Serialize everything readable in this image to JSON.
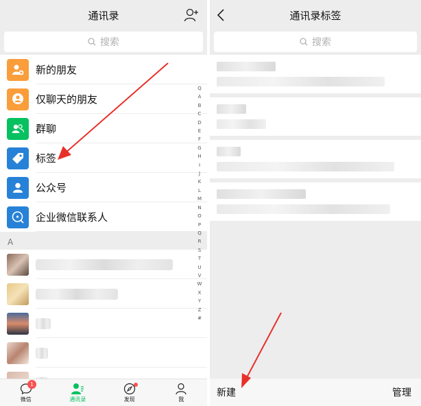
{
  "left": {
    "title": "通讯录",
    "search_placeholder": "搜索",
    "items": [
      {
        "label": "新的朋友",
        "icon": "new-friend-icon",
        "color": "#fa9d3b"
      },
      {
        "label": "仅聊天的朋友",
        "icon": "chat-only-friend-icon",
        "color": "#fa9d3b"
      },
      {
        "label": "群聊",
        "icon": "group-chat-icon",
        "color": "#07c160"
      },
      {
        "label": "标签",
        "icon": "tag-icon",
        "color": "#2782d7"
      },
      {
        "label": "公众号",
        "icon": "official-account-icon",
        "color": "#2782d7"
      },
      {
        "label": "企业微信联系人",
        "icon": "work-contact-icon",
        "color": "#2782d7"
      }
    ],
    "section_letter": "A",
    "index_letters": [
      "Q",
      "A",
      "B",
      "C",
      "D",
      "E",
      "F",
      "G",
      "H",
      "I",
      "J",
      "K",
      "L",
      "M",
      "N",
      "O",
      "P",
      "Q",
      "R",
      "S",
      "T",
      "U",
      "V",
      "W",
      "X",
      "Y",
      "Z",
      "#"
    ],
    "tabs": [
      {
        "label": "微信",
        "icon": "chat-bubble-icon",
        "badge": "1"
      },
      {
        "label": "通讯录",
        "icon": "contacts-icon"
      },
      {
        "label": "发现",
        "icon": "compass-icon"
      },
      {
        "label": "我",
        "icon": "person-icon"
      }
    ]
  },
  "right": {
    "title": "通讯录标签",
    "search_placeholder": "搜索",
    "new_label": "新建",
    "manage_label": "管理"
  },
  "colors": {
    "accent": "#07c160",
    "annotation": "#e8302a",
    "badge": "#fa5151"
  }
}
